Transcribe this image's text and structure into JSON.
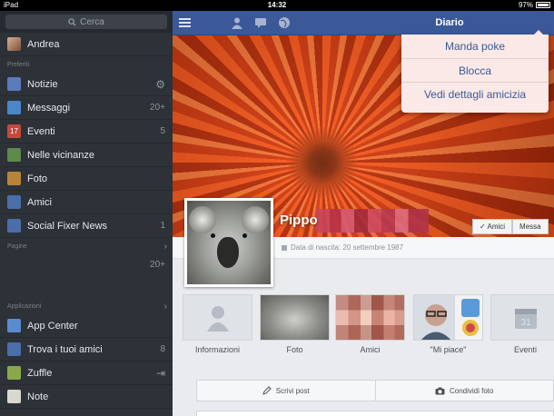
{
  "status_bar": {
    "device": "iPad",
    "time": "14:32",
    "battery": "97%"
  },
  "sidebar": {
    "search_placeholder": "Cerca",
    "user_name": "Andrea",
    "favorites_header": "Preferiti",
    "favorites": [
      {
        "label": "Notizie",
        "icon": "news-feed-icon",
        "color": "#5b7bbd",
        "count": ""
      },
      {
        "label": "Messaggi",
        "icon": "messages-icon",
        "color": "#4a86c8",
        "count": "20+"
      },
      {
        "label": "Eventi",
        "icon": "events-icon",
        "color": "#c44a3a",
        "count": "5",
        "glyph": "17"
      },
      {
        "label": "Nelle vicinanze",
        "icon": "nearby-icon",
        "color": "#5f8a4a",
        "count": ""
      },
      {
        "label": "Foto",
        "icon": "photos-icon",
        "color": "#b8843a",
        "count": ""
      },
      {
        "label": "Amici",
        "icon": "friends-icon",
        "color": "#4a6ea8",
        "count": ""
      },
      {
        "label": "Social Fixer News",
        "icon": "page-icon",
        "color": "#4a6ea8",
        "count": "1"
      }
    ],
    "pages_header": "Pagine",
    "pages_count": "20+",
    "apps_header": "Applicazioni",
    "apps": [
      {
        "label": "App Center",
        "icon": "app-center-icon",
        "color": "#5b8ad0",
        "count": ""
      },
      {
        "label": "Trova i tuoi amici",
        "icon": "find-friends-icon",
        "color": "#4a6ea8",
        "count": "8"
      },
      {
        "label": "Zuffle",
        "icon": "zuffle-icon",
        "color": "#8aa84a",
        "count": ""
      },
      {
        "label": "Note",
        "icon": "notes-icon",
        "color": "#d8d8d0",
        "count": ""
      }
    ]
  },
  "header": {
    "title": "Diario"
  },
  "dropdown": {
    "items": [
      "Manda poke",
      "Blocca",
      "Vedi dettagli amicizia"
    ]
  },
  "profile": {
    "name": "Pippo",
    "birth": "Data di nascita: 20 settembre 1987",
    "friends_button": "✓ Amici",
    "message_button": "Messa"
  },
  "sections": [
    {
      "label": "Informazioni",
      "icon": "person-silhouette-icon"
    },
    {
      "label": "Foto",
      "icon": ""
    },
    {
      "label": "Amici",
      "icon": ""
    },
    {
      "label": "\"Mi piace\"",
      "icon": ""
    },
    {
      "label": "Eventi",
      "icon": "calendar-icon",
      "glyph": "31"
    }
  ],
  "composer": {
    "write_post": "Scrivi post",
    "share_photo": "Condividi foto"
  },
  "colors": {
    "brand_blue": "#3b5998",
    "sidebar_bg": "#2d3138"
  }
}
